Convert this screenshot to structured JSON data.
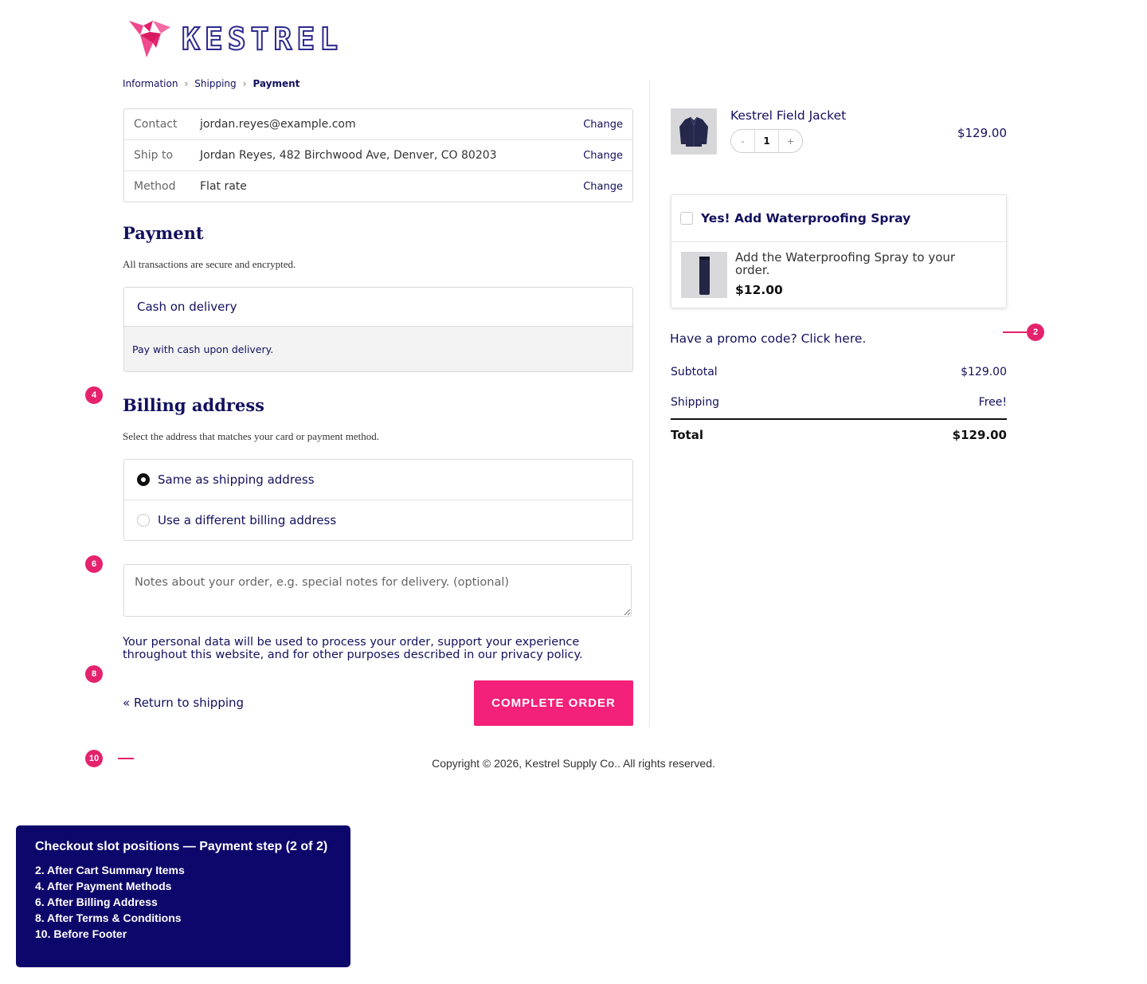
{
  "brand": {
    "name": "KESTREL",
    "logo_color": "#e5226d",
    "text_color": "#2e2a8f"
  },
  "breadcrumb": {
    "items": [
      "Information",
      "Shipping",
      "Payment"
    ],
    "separator": ">"
  },
  "review": {
    "contact": {
      "label": "Contact",
      "value": "jordan.reyes@example.com",
      "action": "Change"
    },
    "ship_to": {
      "label": "Ship to",
      "value": "Jordan Reyes, 482 Birchwood Ave, Denver, CO 80203",
      "action": "Change"
    },
    "method": {
      "label": "Method",
      "value": "Flat rate",
      "action": "Change"
    }
  },
  "payment": {
    "title": "Payment",
    "subtitle": "All transactions are secure and encrypted.",
    "method_label": "Cash on delivery",
    "method_description": "Pay with cash upon delivery."
  },
  "billing": {
    "title": "Billing address",
    "subtitle": "Select the address that matches your card or payment method.",
    "options": [
      {
        "label": "Same as shipping address",
        "selected": true
      },
      {
        "label": "Use a different billing address",
        "selected": false
      }
    ]
  },
  "notes": {
    "placeholder": "Notes about your order, e.g. special notes for delivery. (optional)"
  },
  "privacy_text": "Your personal data will be used to process your order, support your experience throughout this website, and for other purposes described in our privacy policy.",
  "actions": {
    "return_label": "« Return to shipping",
    "complete_label": "COMPLETE ORDER",
    "complete_color": "#f32179"
  },
  "cart": {
    "product_name": "Kestrel Field Jacket",
    "quantity": "1",
    "qty_minus": "-",
    "qty_plus": "+",
    "price": "$129.00"
  },
  "upsell": {
    "title": "Yes! Add Waterproofing Spray",
    "description": "Add the Waterproofing Spray to your order.",
    "price": "$12.00"
  },
  "promo_label": "Have a promo code? Click here.",
  "totals": {
    "subtotal_label": "Subtotal",
    "subtotal_value": "$129.00",
    "shipping_label": "Shipping",
    "shipping_value": "Free!",
    "total_label": "Total",
    "total_value": "$129.00"
  },
  "footer": {
    "copyright": "Copyright © 2026, Kestrel Supply Co.. All rights reserved."
  },
  "markers": [
    "2",
    "4",
    "6",
    "8",
    "10"
  ],
  "legend": {
    "title": "Checkout slot positions — Payment step (2 of 2)",
    "items": [
      "2. After Cart Summary Items",
      "4. After Payment Methods",
      "6. After Billing Address",
      "8. After Terms & Conditions",
      "10. Before Footer"
    ]
  },
  "colors": {
    "accent": "#f32179",
    "text": "#12105e",
    "legend_bg": "#0e076b"
  }
}
